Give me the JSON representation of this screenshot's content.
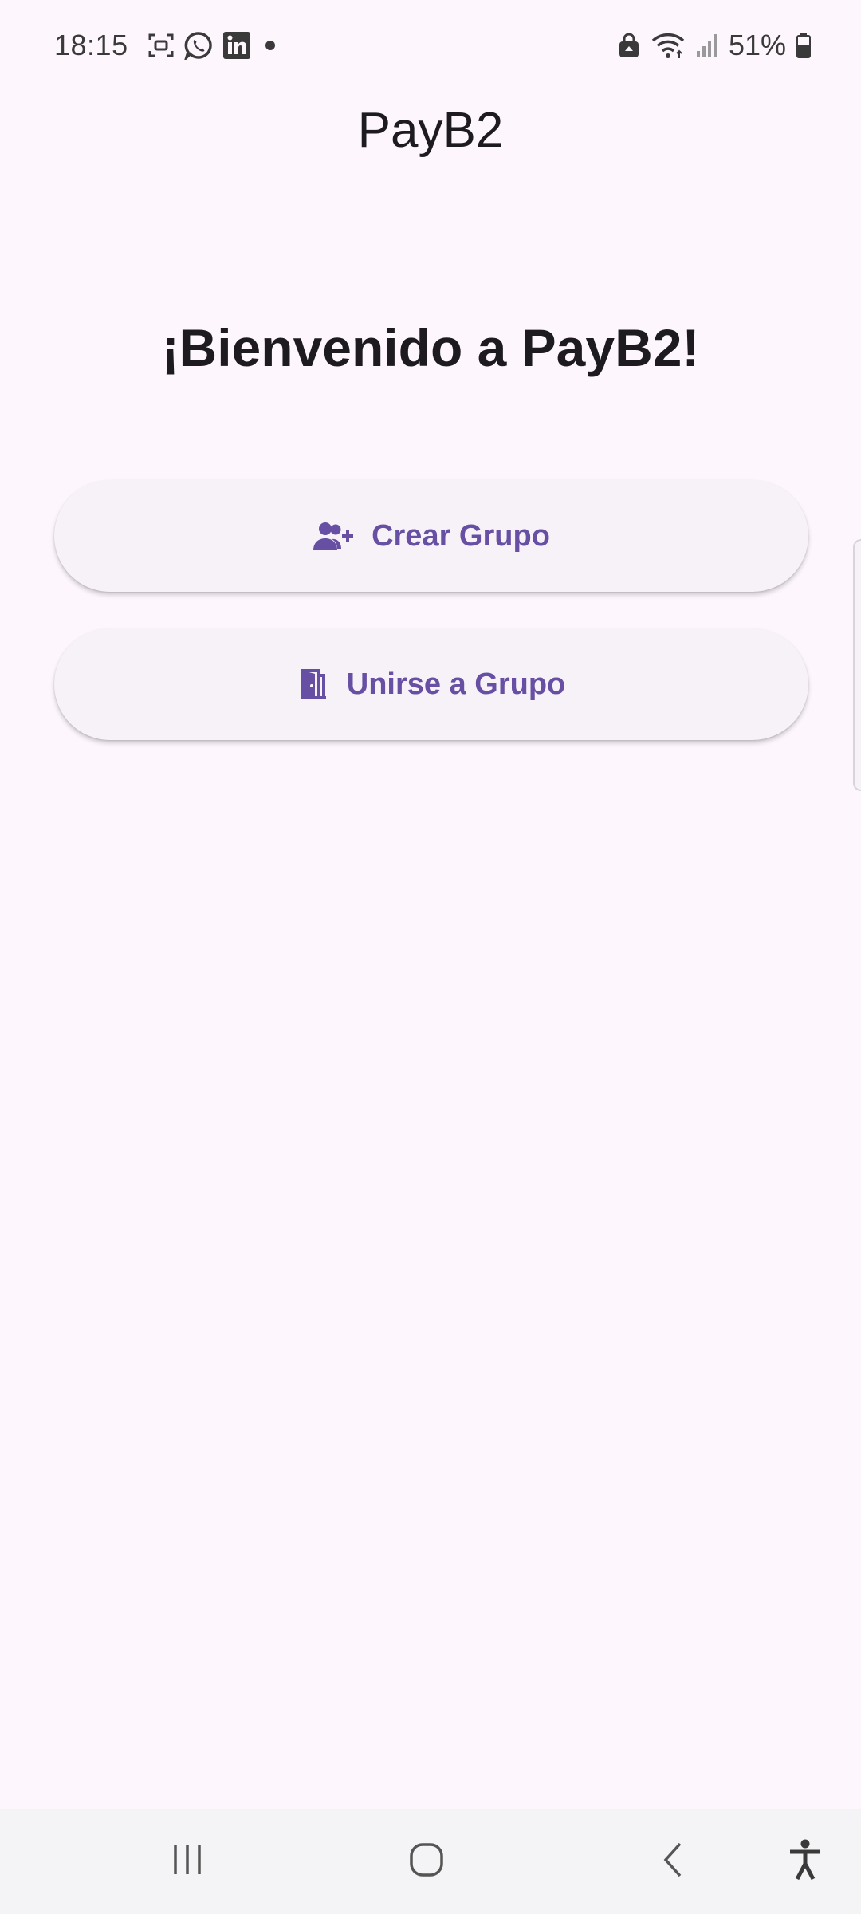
{
  "status_bar": {
    "time": "18:15",
    "battery": "51%",
    "left_icons": [
      "screen-recorder-icon",
      "whatsapp-icon",
      "linkedin-icon",
      "notification-dot-icon"
    ],
    "right_icons": [
      "secure-folder-icon",
      "wifi-icon",
      "signal-icon",
      "battery-icon"
    ]
  },
  "app_bar": {
    "title": "PayB2"
  },
  "main": {
    "welcome": "¡Bienvenido a PayB2!",
    "create_group_label": "Crear Grupo",
    "join_group_label": "Unirse a Grupo"
  },
  "nav_bar": {
    "items": [
      "recents-icon",
      "home-icon",
      "back-icon",
      "accessibility-icon"
    ]
  },
  "colors": {
    "background": "#fdf7fd",
    "accent": "#6750a4",
    "button_bg": "#f6f2f8",
    "text": "#1d1b20"
  }
}
